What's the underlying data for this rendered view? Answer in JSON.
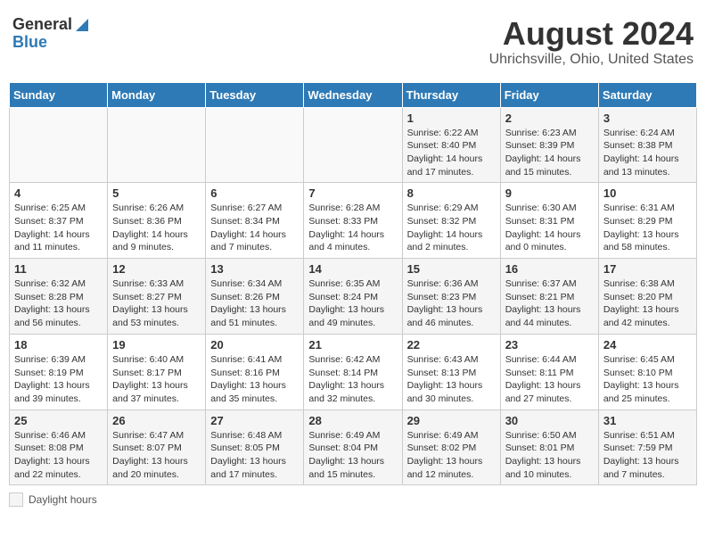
{
  "header": {
    "logo_general": "General",
    "logo_blue": "Blue",
    "title": "August 2024",
    "subtitle": "Uhrichsville, Ohio, United States"
  },
  "calendar": {
    "days_of_week": [
      "Sunday",
      "Monday",
      "Tuesday",
      "Wednesday",
      "Thursday",
      "Friday",
      "Saturday"
    ],
    "weeks": [
      [
        {
          "day": "",
          "info": ""
        },
        {
          "day": "",
          "info": ""
        },
        {
          "day": "",
          "info": ""
        },
        {
          "day": "",
          "info": ""
        },
        {
          "day": "1",
          "info": "Sunrise: 6:22 AM\nSunset: 8:40 PM\nDaylight: 14 hours and 17 minutes."
        },
        {
          "day": "2",
          "info": "Sunrise: 6:23 AM\nSunset: 8:39 PM\nDaylight: 14 hours and 15 minutes."
        },
        {
          "day": "3",
          "info": "Sunrise: 6:24 AM\nSunset: 8:38 PM\nDaylight: 14 hours and 13 minutes."
        }
      ],
      [
        {
          "day": "4",
          "info": "Sunrise: 6:25 AM\nSunset: 8:37 PM\nDaylight: 14 hours and 11 minutes."
        },
        {
          "day": "5",
          "info": "Sunrise: 6:26 AM\nSunset: 8:36 PM\nDaylight: 14 hours and 9 minutes."
        },
        {
          "day": "6",
          "info": "Sunrise: 6:27 AM\nSunset: 8:34 PM\nDaylight: 14 hours and 7 minutes."
        },
        {
          "day": "7",
          "info": "Sunrise: 6:28 AM\nSunset: 8:33 PM\nDaylight: 14 hours and 4 minutes."
        },
        {
          "day": "8",
          "info": "Sunrise: 6:29 AM\nSunset: 8:32 PM\nDaylight: 14 hours and 2 minutes."
        },
        {
          "day": "9",
          "info": "Sunrise: 6:30 AM\nSunset: 8:31 PM\nDaylight: 14 hours and 0 minutes."
        },
        {
          "day": "10",
          "info": "Sunrise: 6:31 AM\nSunset: 8:29 PM\nDaylight: 13 hours and 58 minutes."
        }
      ],
      [
        {
          "day": "11",
          "info": "Sunrise: 6:32 AM\nSunset: 8:28 PM\nDaylight: 13 hours and 56 minutes."
        },
        {
          "day": "12",
          "info": "Sunrise: 6:33 AM\nSunset: 8:27 PM\nDaylight: 13 hours and 53 minutes."
        },
        {
          "day": "13",
          "info": "Sunrise: 6:34 AM\nSunset: 8:26 PM\nDaylight: 13 hours and 51 minutes."
        },
        {
          "day": "14",
          "info": "Sunrise: 6:35 AM\nSunset: 8:24 PM\nDaylight: 13 hours and 49 minutes."
        },
        {
          "day": "15",
          "info": "Sunrise: 6:36 AM\nSunset: 8:23 PM\nDaylight: 13 hours and 46 minutes."
        },
        {
          "day": "16",
          "info": "Sunrise: 6:37 AM\nSunset: 8:21 PM\nDaylight: 13 hours and 44 minutes."
        },
        {
          "day": "17",
          "info": "Sunrise: 6:38 AM\nSunset: 8:20 PM\nDaylight: 13 hours and 42 minutes."
        }
      ],
      [
        {
          "day": "18",
          "info": "Sunrise: 6:39 AM\nSunset: 8:19 PM\nDaylight: 13 hours and 39 minutes."
        },
        {
          "day": "19",
          "info": "Sunrise: 6:40 AM\nSunset: 8:17 PM\nDaylight: 13 hours and 37 minutes."
        },
        {
          "day": "20",
          "info": "Sunrise: 6:41 AM\nSunset: 8:16 PM\nDaylight: 13 hours and 35 minutes."
        },
        {
          "day": "21",
          "info": "Sunrise: 6:42 AM\nSunset: 8:14 PM\nDaylight: 13 hours and 32 minutes."
        },
        {
          "day": "22",
          "info": "Sunrise: 6:43 AM\nSunset: 8:13 PM\nDaylight: 13 hours and 30 minutes."
        },
        {
          "day": "23",
          "info": "Sunrise: 6:44 AM\nSunset: 8:11 PM\nDaylight: 13 hours and 27 minutes."
        },
        {
          "day": "24",
          "info": "Sunrise: 6:45 AM\nSunset: 8:10 PM\nDaylight: 13 hours and 25 minutes."
        }
      ],
      [
        {
          "day": "25",
          "info": "Sunrise: 6:46 AM\nSunset: 8:08 PM\nDaylight: 13 hours and 22 minutes."
        },
        {
          "day": "26",
          "info": "Sunrise: 6:47 AM\nSunset: 8:07 PM\nDaylight: 13 hours and 20 minutes."
        },
        {
          "day": "27",
          "info": "Sunrise: 6:48 AM\nSunset: 8:05 PM\nDaylight: 13 hours and 17 minutes."
        },
        {
          "day": "28",
          "info": "Sunrise: 6:49 AM\nSunset: 8:04 PM\nDaylight: 13 hours and 15 minutes."
        },
        {
          "day": "29",
          "info": "Sunrise: 6:49 AM\nSunset: 8:02 PM\nDaylight: 13 hours and 12 minutes."
        },
        {
          "day": "30",
          "info": "Sunrise: 6:50 AM\nSunset: 8:01 PM\nDaylight: 13 hours and 10 minutes."
        },
        {
          "day": "31",
          "info": "Sunrise: 6:51 AM\nSunset: 7:59 PM\nDaylight: 13 hours and 7 minutes."
        }
      ]
    ]
  },
  "footer": {
    "daylight_label": "Daylight hours"
  }
}
